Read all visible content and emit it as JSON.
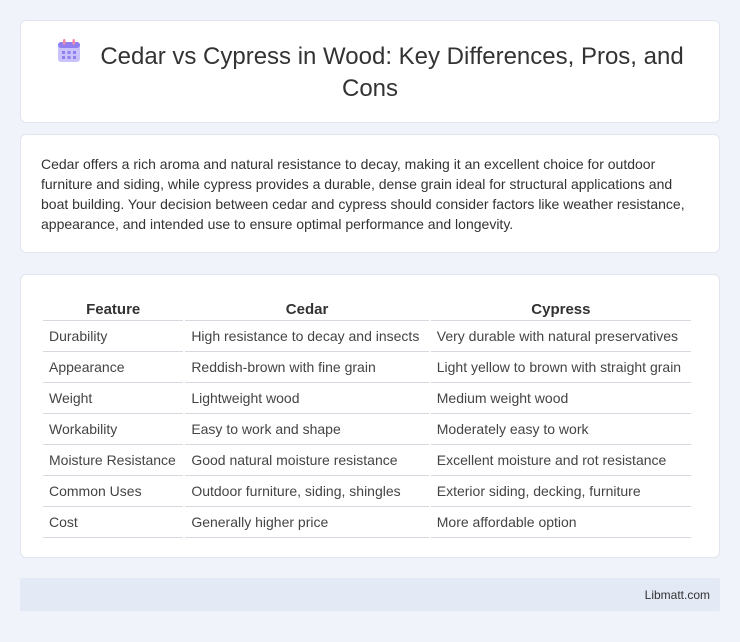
{
  "header": {
    "title": "Cedar vs Cypress in Wood: Key Differences, Pros, and Cons",
    "icon": "calendar-icon"
  },
  "summary": {
    "text": "Cedar offers a rich aroma and natural resistance to decay, making it an excellent choice for outdoor furniture and siding, while cypress provides a durable, dense grain ideal for structural applications and boat building. Your decision between cedar and cypress should consider factors like weather resistance, appearance, and intended use to ensure optimal performance and longevity."
  },
  "table": {
    "headers": [
      "Feature",
      "Cedar",
      "Cypress"
    ],
    "rows": [
      [
        "Durability",
        "High resistance to decay and insects",
        "Very durable with natural preservatives"
      ],
      [
        "Appearance",
        "Reddish-brown with fine grain",
        "Light yellow to brown with straight grain"
      ],
      [
        "Weight",
        "Lightweight wood",
        "Medium weight wood"
      ],
      [
        "Workability",
        "Easy to work and shape",
        "Moderately easy to work"
      ],
      [
        "Moisture Resistance",
        "Good natural moisture resistance",
        "Excellent moisture and rot resistance"
      ],
      [
        "Common Uses",
        "Outdoor furniture, siding, shingles",
        "Exterior siding, decking, furniture"
      ],
      [
        "Cost",
        "Generally higher price",
        "More affordable option"
      ]
    ]
  },
  "footer": {
    "site": "Libmatt.com"
  },
  "colors": {
    "background": "#f0f3f9",
    "card": "#ffffff",
    "footer": "#e3e9f5",
    "icon_purple": "#8f7ff0",
    "icon_pink": "#f08aa8"
  }
}
